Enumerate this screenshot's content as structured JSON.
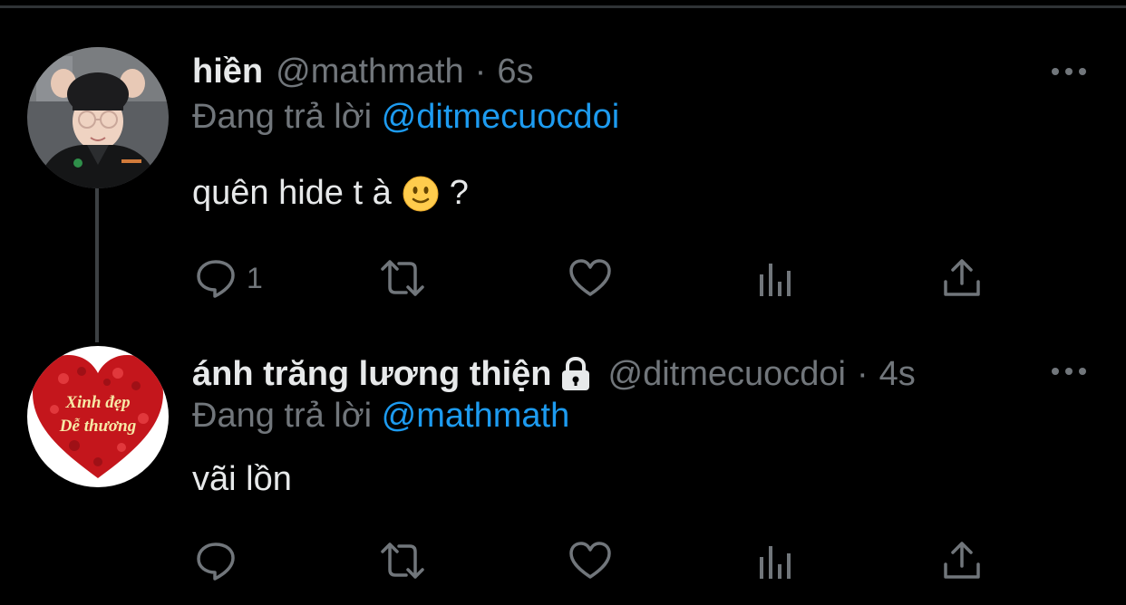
{
  "tweets": [
    {
      "name": "hiền",
      "handle": "@mathmath",
      "separator": "·",
      "time": "6s",
      "reply_prefix": "Đang trả lời",
      "reply_to": "@ditmecuocdoi",
      "text": "quên hide t à",
      "text_suffix": "?",
      "emoji": "slightly-smiling-face-icon",
      "reply_count": "1",
      "protected": false
    },
    {
      "name": "ánh trăng lương thiện",
      "handle": "@ditmecuocdoi",
      "separator": "·",
      "time": "4s",
      "reply_prefix": "Đang trả lời",
      "reply_to": "@mathmath",
      "text": "vãi lồn",
      "reply_count": "",
      "protected": true,
      "avatar_text_line1": "Xinh đẹp",
      "avatar_text_line2": "Dễ thương"
    }
  ],
  "colors": {
    "background": "#000000",
    "primary_text": "#e7e9ea",
    "secondary_text": "#71767b",
    "accent": "#1d9bf0",
    "thread_line": "#3d4144"
  }
}
